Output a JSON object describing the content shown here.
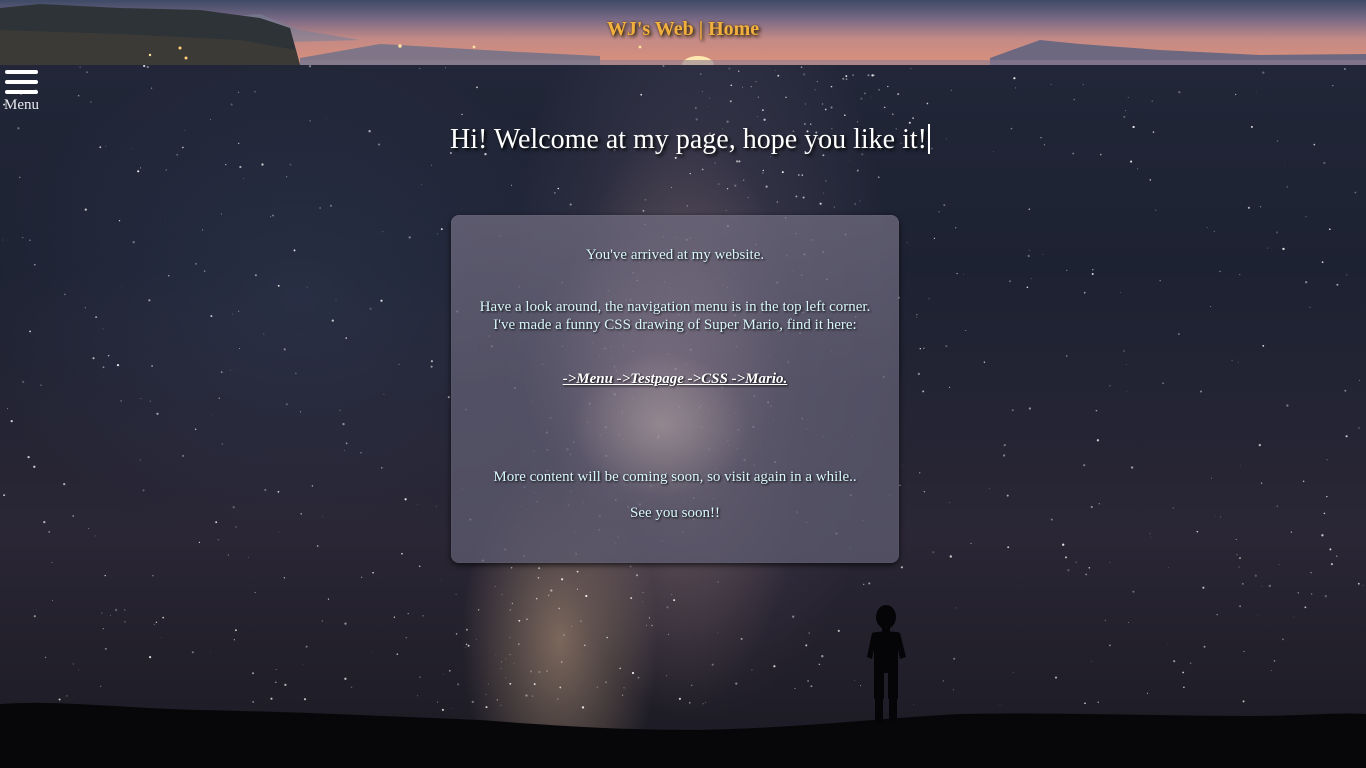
{
  "header": {
    "title": "WJ's Web | Home"
  },
  "menu": {
    "label": "Menu",
    "icon": "hamburger-icon"
  },
  "main": {
    "heading": "Hi! Welcome at my page, hope you like it!"
  },
  "card": {
    "line1": "You've arrived at my website.",
    "line2": "Have a look around, the navigation menu is in the top left corner.",
    "line3": "I've made a funny CSS drawing of Super Mario, find it here:",
    "link": "->Menu ->Testpage ->CSS ->Mario.",
    "line4": "More content will be coming soon, so visit again in a while..",
    "line5": "See you soon!!"
  },
  "colors": {
    "title": "#f2b040",
    "card_text": "#d8f6fb",
    "heading": "#ffffff"
  }
}
